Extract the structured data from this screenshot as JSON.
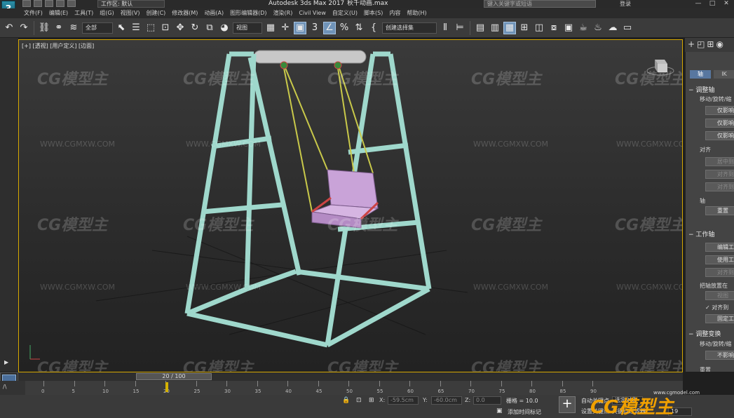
{
  "titlebar": {
    "logo": "3",
    "workspace": "工作区: 默认",
    "app_title": "Autodesk 3ds Max 2017",
    "file_name": "秋千动画.max",
    "search_placeholder": "键入关键字或短语",
    "login": "登录",
    "win_min": "—",
    "win_max": "□",
    "win_close": "✕"
  },
  "menubar": {
    "items": [
      "文件(F)",
      "编辑(E)",
      "工具(T)",
      "组(G)",
      "视图(V)",
      "创建(C)",
      "修改器(M)",
      "动画(A)",
      "图形编辑器(D)",
      "渲染(R)",
      "Civil View",
      "自定义(U)",
      "脚本(S)",
      "内容",
      "帮助(H)"
    ]
  },
  "toolbar": {
    "filter_label": "全部",
    "view_label": "视图",
    "selection_set": "创建选择集"
  },
  "viewport": {
    "label": "[+] [透视] [用户定义] [边面]",
    "watermark_text": "CG模型主",
    "watermark_url": "WWW.CGMXW.COM"
  },
  "command_panel": {
    "tab_pivot": "轴",
    "tab_ik": "IK",
    "section_adjust_pivot": "调整轴",
    "move_rotate_scale": "移动/旋转/缩",
    "affect_pivot_only": "仅影响",
    "affect_object_only": "仅影响",
    "affect_hierarchy_only": "仅影响",
    "align_label": "对齐",
    "center_to_object": "居中到",
    "align_to_object": "对齐到",
    "align_to_world": "对齐到",
    "pivot_label": "轴",
    "reset_pivot": "重置",
    "section_working_pivot": "工作轴",
    "edit_working_pivot": "编辑工",
    "use_working_pivot": "使用工作",
    "align_to_view": "对齐到视",
    "place_pivot_to": "把轴放置在",
    "view_label": "视图",
    "align_to_check": "对齐到",
    "fix_working": "固定工作",
    "section_adjust_transform": "调整变换",
    "move_rotate_scale2": "移动/旋转/缩",
    "dont_affect": "不影响",
    "reset_label": "重置"
  },
  "timeline": {
    "current": "20 / 100",
    "ticks": [
      "0",
      "5",
      "10",
      "15",
      "20",
      "25",
      "30",
      "35",
      "40",
      "45",
      "50",
      "55",
      "60",
      "65",
      "70",
      "75",
      "80",
      "85",
      "90"
    ],
    "key_frame": 20
  },
  "statusbar": {
    "x_label": "X:",
    "x_value": "-59.5cm",
    "y_label": "Y:",
    "y_value": "-60.0cm",
    "z_label": "Z:",
    "z_value": "0.0",
    "grid_label": "栅格 = 10.0",
    "auto_key": "自动关键点",
    "selected": "选定对象",
    "set_key": "设置关键点",
    "key_filter": "关键点过滤器",
    "add_time_tag": "添加时间标记",
    "frame_value": "19",
    "logo_text": "CG模型主",
    "logo_url": "www.cgmodel.com"
  },
  "colors": {
    "accent": "#6f93b8",
    "frame_green": "#9fd8cc",
    "seat_purple": "#c9a3d8",
    "viewport_border": "#d6a800",
    "logo_orange": "#f0a000"
  }
}
